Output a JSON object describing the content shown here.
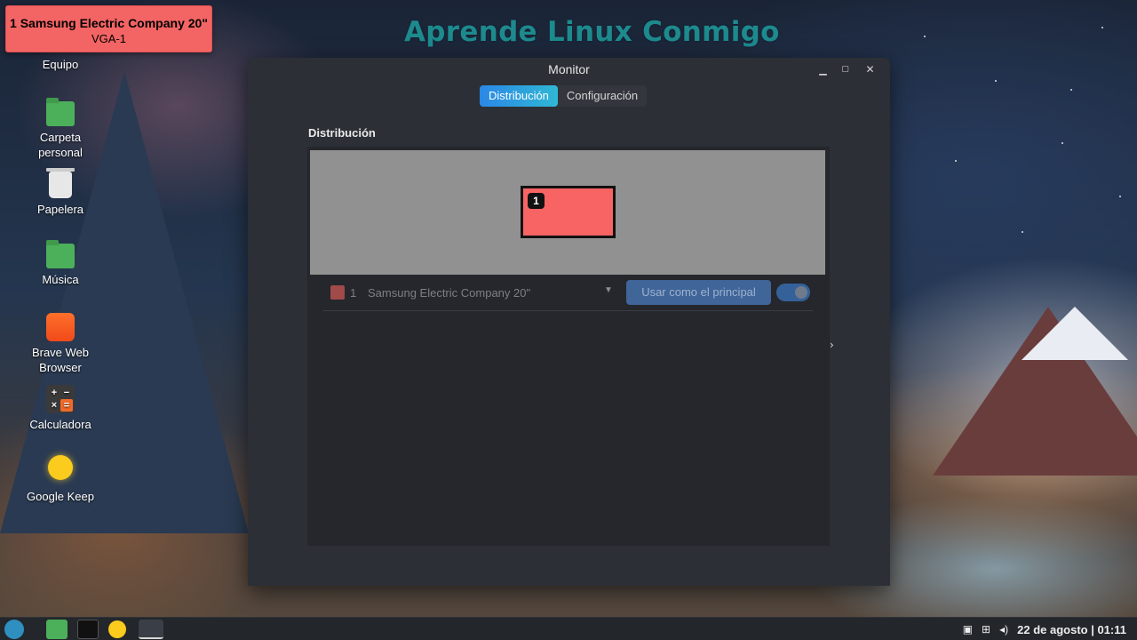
{
  "desktop": {
    "watermark": "Aprende Linux Conmigo",
    "icons": [
      {
        "label_1": "Equipo",
        "label_2": ""
      },
      {
        "label_1": "Carpeta",
        "label_2": "personal"
      },
      {
        "label_1": "Papelera",
        "label_2": ""
      },
      {
        "label_1": "Música",
        "label_2": ""
      },
      {
        "label_1": "Brave Web",
        "label_2": "Browser"
      },
      {
        "label_1": "Calculadora",
        "label_2": ""
      },
      {
        "label_1": "Google Keep",
        "label_2": ""
      }
    ]
  },
  "osd": {
    "line1": "1  Samsung Electric Company 20\"",
    "line2": "VGA-1",
    "color": "#f36464"
  },
  "window": {
    "title": "Monitor",
    "tabs": [
      {
        "label": "Distribución",
        "active": true
      },
      {
        "label": "Configuración",
        "active": false
      }
    ],
    "section_title": "Distribución",
    "arrangement": {
      "monitor_number": "1",
      "monitor_color": "#f86464"
    },
    "monitor_row": {
      "number": "1",
      "name": "Samsung Electric Company 20\"",
      "primary_button": "Usar como el principal",
      "enabled": true
    },
    "controls": {
      "minimize_icon": "minimize-icon",
      "maximize_icon": "maximize-icon",
      "close_icon": "close-icon"
    }
  },
  "taskbar": {
    "clock": "22 de agosto | 01:11",
    "items": [
      "menu-icon",
      "file-manager-icon",
      "terminal-icon",
      "google-keep-icon",
      "display-settings-icon"
    ],
    "tray": [
      "printer-icon",
      "network-icon",
      "volume-icon"
    ]
  }
}
